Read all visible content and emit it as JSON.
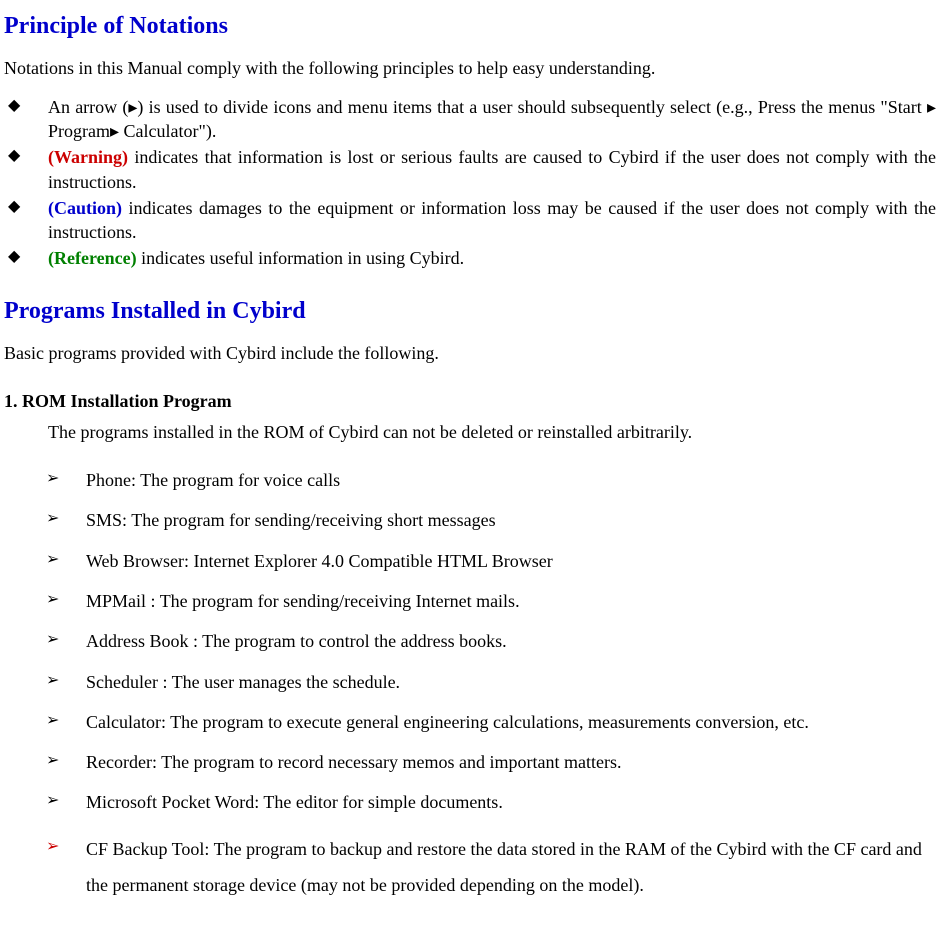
{
  "heading1": "Principle of Notations",
  "intro1": "Notations in this Manual comply with the following principles to help easy understanding.",
  "bullets1": {
    "0": {
      "label": "",
      "text": "An arrow (▸) is used to divide icons and menu items that a user should subsequently select (e.g., Press the menus \"Start ▸ Program▸ Calculator\")."
    },
    "1": {
      "label": "(Warning)",
      "text": " indicates that information is lost or serious faults are caused to Cybird if the user does not comply with the instructions."
    },
    "2": {
      "label": "(Caution)",
      "text": " indicates damages to the equipment or information loss may be caused if the user does not comply with the instructions."
    },
    "3": {
      "label": "(Reference)",
      "text": " indicates useful information in using Cybird."
    }
  },
  "heading2": "Programs Installed in Cybird",
  "intro2": "Basic programs provided with Cybird include the following.",
  "romTitle": "1. ROM Installation Program",
  "romDesc": "The programs installed in the ROM of Cybird can not be deleted or reinstalled arbitrarily.",
  "romItems": {
    "0": "Phone: The program for voice calls",
    "1": "SMS: The program for sending/receiving short messages",
    "2": "Web Browser: Internet Explorer 4.0 Compatible HTML Browser",
    "3": "MPMail : The program for sending/receiving Internet mails.",
    "4": "Address Book : The program to control the address books.",
    "5": "Scheduler : The user manages the schedule.",
    "6": "Calculator: The program to execute general engineering calculations, measurements conversion, etc.",
    "7": "Recorder: The program to record necessary memos and important matters.",
    "8": "Microsoft Pocket Word: The editor for simple documents.",
    "9": "CF Backup Tool: The program to backup and restore the data stored in the RAM of the Cybird with the CF card and the permanent storage device (may not be provided depending on the model)."
  }
}
